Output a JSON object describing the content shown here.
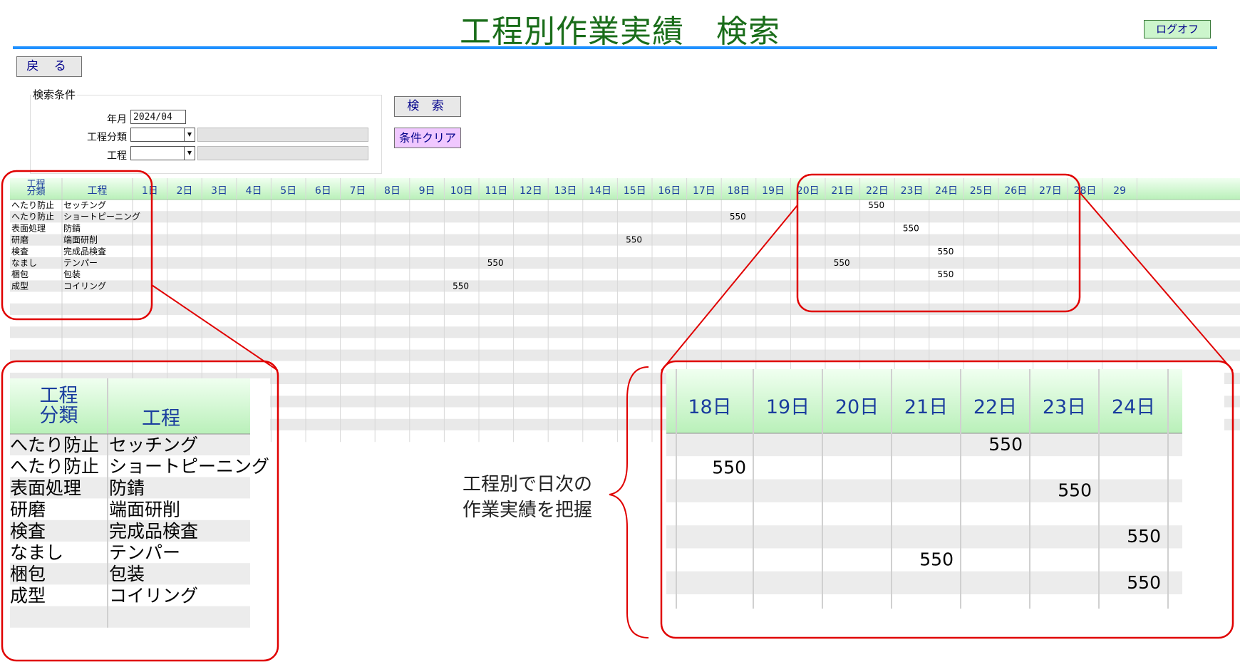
{
  "header": {
    "title": "工程別作業実績　検索",
    "logoff_label": "ログオフ"
  },
  "back_label": "戻 る",
  "conditions": {
    "group_label": "検索条件",
    "year_month_label": "年月",
    "year_month_value": "2024/04",
    "process_category_label": "工程分類",
    "process_label": "工程",
    "search_button": "検 索",
    "clear_button": "条件クリア"
  },
  "table": {
    "col_category": "工程\n分類",
    "col_process": "工程",
    "days": [
      "1日",
      "2日",
      "3日",
      "4日",
      "5日",
      "6日",
      "7日",
      "8日",
      "9日",
      "10日",
      "11日",
      "12日",
      "13日",
      "14日",
      "15日",
      "16日",
      "17日",
      "18日",
      "19日",
      "20日",
      "21日",
      "22日",
      "23日",
      "24日",
      "25日",
      "26日",
      "27日",
      "28日",
      "29"
    ],
    "rows": [
      {
        "category": "へたり防止",
        "process": "セッチング",
        "values": {
          "22": "550"
        }
      },
      {
        "category": "へたり防止",
        "process": "ショートピーニング",
        "values": {
          "18": "550"
        }
      },
      {
        "category": "表面処理",
        "process": "防錆",
        "values": {
          "23": "550"
        }
      },
      {
        "category": "研磨",
        "process": "端面研削",
        "values": {
          "15": "550"
        }
      },
      {
        "category": "検査",
        "process": "完成品検査",
        "values": {
          "24": "550"
        }
      },
      {
        "category": "なまし",
        "process": "テンパー",
        "values": {
          "11": "550",
          "21": "550"
        }
      },
      {
        "category": "梱包",
        "process": "包装",
        "values": {
          "24": "550"
        }
      },
      {
        "category": "成型",
        "process": "コイリング",
        "values": {
          "10": "550"
        }
      }
    ]
  },
  "annotation": "工程別で日次の\n作業実績を把握",
  "colors": {
    "title": "#1a6d1a",
    "accent_bar": "#1e90ff",
    "highlight": "#e00000",
    "header_green": "#ccf5cc"
  }
}
